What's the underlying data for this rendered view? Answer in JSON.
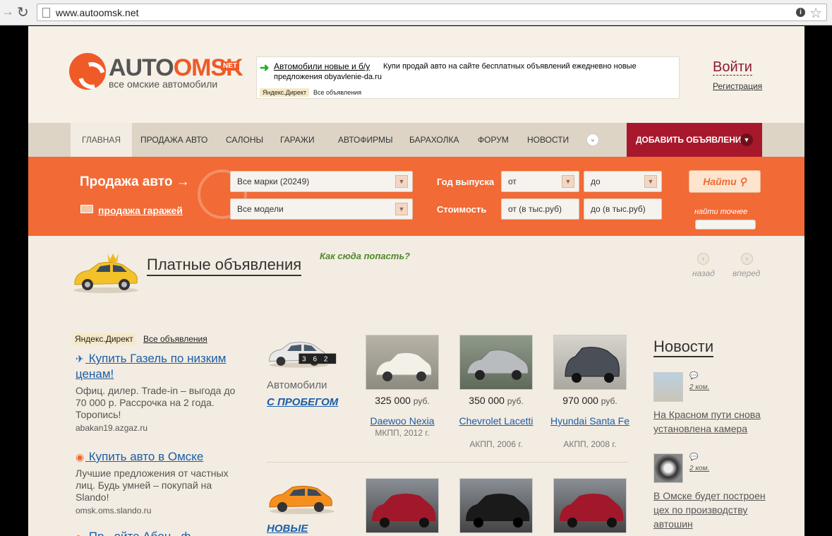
{
  "browser": {
    "url": "www.autoomsk.net"
  },
  "logo": {
    "main_a": "AUTO",
    "main_b": "OMSK",
    "net": "NET",
    "sub": "все омские автомобили"
  },
  "top_ad": {
    "link": "Автомобили новые и б/у",
    "text": "Купи продай авто на сайте бесплатных объявлений ежедневно новые предложения obyavlenie-da.ru",
    "source": "Яндекс.Директ",
    "all": "Все объявления"
  },
  "auth": {
    "login": "Войти",
    "register": "Регистрация"
  },
  "nav": {
    "items": [
      "ГЛАВНАЯ",
      "ПРОДАЖА АВТО",
      "САЛОНЫ",
      "ГАРАЖИ",
      "АВТОФИРМЫ",
      "БАРАХОЛКА",
      "ФОРУМ",
      "НОВОСТИ"
    ],
    "add": "ДОБАВИТЬ ОБЪЯВЛЕНИЕ"
  },
  "search": {
    "title": "Продажа авто →",
    "garage_link": "продажа гаражей",
    "brand": "Все марки (20249)",
    "model": "Все модели",
    "year_label": "Год выпуска",
    "year_from": "от",
    "year_to": "до",
    "price_label": "Стоимость",
    "price_from": "от (в тыс.руб)",
    "price_to": "до (в тыс.руб)",
    "find": "Найти",
    "find_exact": "найти точнее"
  },
  "paid": {
    "title": "Платные объявления",
    "how": "Как сюда попасть?",
    "prev": "назад",
    "next": "вперед"
  },
  "direct": {
    "source": "Яндекс.Директ",
    "all": "Все объявления",
    "ads": [
      {
        "title": "Купить Газель по низким ценам!",
        "body": "Офиц. дилер. Trade-in – выгода до 70 000 р. Рассрочка на 2 года. Торопись!",
        "domain": "abakan19.azgaz.ru"
      },
      {
        "title": "Купить авто в Омске",
        "body": "Лучшие предложения от частных лиц. Будь умней – покупай на Slando!",
        "domain": "omsk.oms.slando.ru"
      },
      {
        "title": "Пр...ойте Абон...ф",
        "body": "",
        "domain": ""
      }
    ]
  },
  "used": {
    "label": "Автомобили",
    "link": "С ПРОБЕГОМ",
    "counter": [
      "3",
      "6",
      "2"
    ],
    "cars": [
      {
        "price": "325 000",
        "currency": "руб.",
        "name": "Daewoo Nexia",
        "spec": "МКПП, 2012 г."
      },
      {
        "price": "350 000",
        "currency": "руб.",
        "name": "Chevrolet Lacetti",
        "spec": "АКПП, 2006 г."
      },
      {
        "price": "970 000",
        "currency": "руб.",
        "name": "Hyundai Santa Fe",
        "spec": "АКПП, 2008 г."
      }
    ]
  },
  "new_cars": {
    "link": "НОВЫЕ"
  },
  "news": {
    "title": "Новости",
    "items": [
      {
        "date": "2 ком.",
        "title": "На Красном пути снова установлена камера"
      },
      {
        "date": "2 ком.",
        "title": "В Омске будет построен цех по производству автошин"
      }
    ]
  },
  "colors": {
    "orange": "#f26a35",
    "brand_red": "#a8182c",
    "link_blue": "#1a5ea8",
    "page_bg": "#f3ece2"
  }
}
